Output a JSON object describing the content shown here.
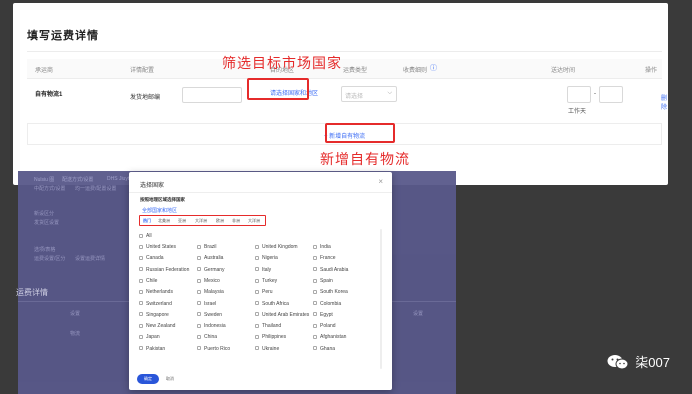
{
  "page": {
    "title": "填写运费详情",
    "columns": [
      "承运商",
      "详情配置",
      "目的地区",
      "运费类型",
      "收费细则",
      "",
      "送达时间",
      "",
      "操作"
    ],
    "row": {
      "name": "自有物流1",
      "fee_label": "发货地邮编",
      "select_country_link": "请选择国家和地区",
      "select_placeholder": "请选择",
      "time_sep": "-",
      "time_unit": "工作天",
      "action": "删除"
    },
    "add_button": "+ 新增自有物流"
  },
  "callouts": {
    "filter_markets": "筛选目标市场国家",
    "add_logistics": "新增自有物流"
  },
  "background": {
    "title": "运费详情",
    "line1": [
      "Nulsiu 图",
      "配送方式/设置",
      "DHS Jiuyt"
    ],
    "line2": [
      "中配方式/设置",
      "均一运费/配置设置"
    ],
    "line3": [
      "新设区分",
      "发货区设置"
    ],
    "line4": [
      "选项/表格",
      "运费设置/区分"
    ],
    "line5": [
      "价格/运费设定",
      "设置运费详情"
    ],
    "row_a": "设置",
    "row_b": "物流",
    "row_c": "设置"
  },
  "modal": {
    "title": "选择国家",
    "close": "×",
    "hint": "按照地理区域选择国家",
    "select_all": "全部国家和地区",
    "tabs": [
      "热门",
      "北美洲",
      "亚洲",
      "大洋洲",
      "欧洲",
      "非洲",
      "大洋洲"
    ],
    "all_label": "All",
    "countries": [
      [
        "United States",
        "Brazil",
        "United Kingdom",
        "India"
      ],
      [
        "Canada",
        "Australia",
        "Nigeria",
        "France"
      ],
      [
        "Russian Federation",
        "Germany",
        "Italy",
        "Saudi Arabia"
      ],
      [
        "Chile",
        "Mexico",
        "Turkey",
        "Spain"
      ],
      [
        "Netherlands",
        "Malaysia",
        "Peru",
        "South Korea"
      ],
      [
        "Switzerland",
        "Israel",
        "South Africa",
        "Colombia"
      ],
      [
        "Singapore",
        "Sweden",
        "United Arab Emirates",
        "Egypt"
      ],
      [
        "New Zealand",
        "Indonesia",
        "Thailand",
        "Poland"
      ],
      [
        "Japan",
        "China",
        "Philippines",
        "Afghanistan"
      ],
      [
        "Pakistan",
        "Puerto Rico",
        "Ukraine",
        "Ghana"
      ]
    ],
    "confirm": "确定",
    "cancel": "取消"
  },
  "watermark": "柒007",
  "colors": {
    "accent": "#3c6df5",
    "highlight_red": "#e52b2b",
    "overlay": "#58588a"
  }
}
